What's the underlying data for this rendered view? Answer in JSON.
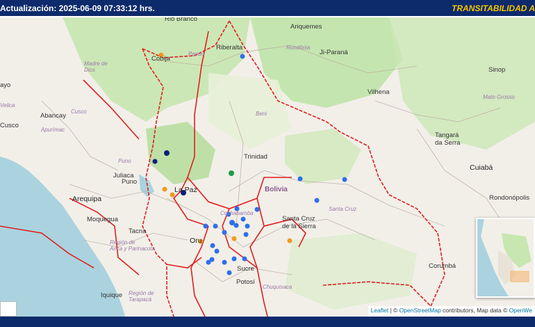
{
  "header": {
    "update_label": "Actualización: 2025-06-09 07:33:12 hrs.",
    "title": "TRANSITABILIDAD A"
  },
  "map": {
    "labels": {
      "rio_branco": "Rio Branco",
      "ariquemes": "Ariquemes",
      "rondonia": "Rondônia",
      "ji_parana": "Ji-Paraná",
      "riberalta": "Riberalta",
      "cobija": "Cobija",
      "pando": "Pando",
      "madre_de_dios": "Madre de\nDios",
      "vilhena": "Vilhena",
      "sinop": "Sinop",
      "mato_grosso": "Mato Grosso",
      "ayo": "ayo",
      "velica": "Velica",
      "abancay": "Abancay",
      "cusco_reg": "Cusco",
      "apurimac": "Apurímac",
      "cusco_city": "Cusco",
      "beni": "Beni",
      "tangara": "Tangará\nda Serra",
      "trinidad": "Trinidad",
      "cuiaba": "Cuiabá",
      "puno_reg": "Puno",
      "juliaca": "Juliaca",
      "puno_city": "Puno",
      "la_paz": "La Paz",
      "bolivia": "Bolivia",
      "rondonopolis": "Rondonópolis",
      "arequipa": "Arequipa",
      "santa_cruz_reg": "Santa Cruz",
      "cochabamba": "Cochabamba",
      "moquegua": "Moquegua",
      "scz_city": "Santa Cruz\nde la Sierra",
      "tacna": "Tacna",
      "arica": "Región de\nArica y Parinacota",
      "oruro": "Oru",
      "sucre": "Sucre",
      "potosi": "Potosí",
      "corumba": "Corumbá",
      "iquique": "Iquique",
      "chuquisaca": "Chuquisaca",
      "tarapaca": "Región de\nTarapacá"
    }
  },
  "attribution": {
    "leaflet": "Leaflet",
    "sep": " | © ",
    "osm": "OpenStreetMap",
    "contrib": " contributors, Map data © ",
    "openweather": "OpenWe"
  },
  "colors": {
    "header_bg": "#0d2a6b",
    "title": "#f5c400",
    "border": "#e01e1e",
    "marker_blue": "#2f6fe8",
    "marker_orange": "#f29a1c",
    "marker_navy": "#0a1f7a",
    "marker_green": "#1f9a4a"
  },
  "icons": [
    "zoom-in-icon"
  ]
}
